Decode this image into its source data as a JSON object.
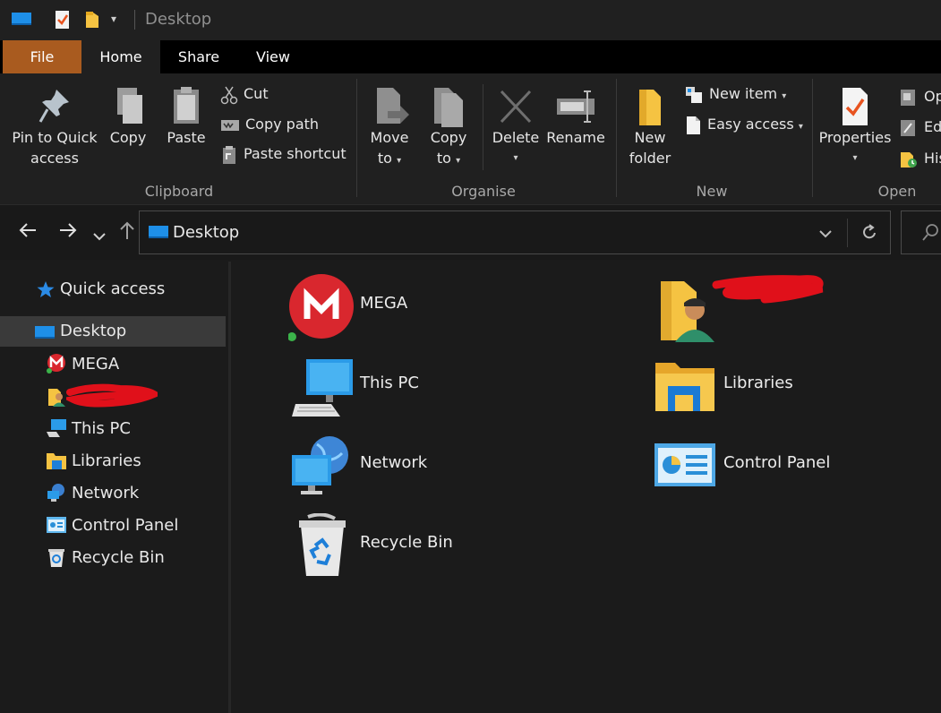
{
  "window": {
    "title": "Desktop"
  },
  "tabs": [
    {
      "label": "File"
    },
    {
      "label": "Home"
    },
    {
      "label": "Share"
    },
    {
      "label": "View"
    }
  ],
  "ribbon": {
    "clipboard": {
      "label": "Clipboard",
      "pin_quick_access": [
        "Pin to Quick",
        "access"
      ],
      "copy": "Copy",
      "paste": "Paste",
      "cut": "Cut",
      "copy_path": "Copy path",
      "paste_shortcut": "Paste shortcut"
    },
    "organise": {
      "label": "Organise",
      "move_to": [
        "Move",
        "to"
      ],
      "copy_to": [
        "Copy",
        "to"
      ],
      "delete": "Delete",
      "rename": "Rename"
    },
    "new": {
      "label": "New",
      "new_folder": [
        "New",
        "folder"
      ],
      "new_item": "New item",
      "easy_access": "Easy access"
    },
    "open": {
      "label": "Open",
      "properties": "Properties",
      "open_partial": "Op",
      "edit_partial": "Edi",
      "history_partial": "His"
    }
  },
  "address": {
    "path": "Desktop"
  },
  "sidebar": {
    "items": [
      {
        "label": "Quick access",
        "icon": "star-icon"
      },
      {
        "label": "Desktop",
        "icon": "desktop-icon",
        "selected": true
      },
      {
        "label": "MEGA",
        "icon": "mega-icon"
      },
      {
        "label": "",
        "icon": "user-folder-icon",
        "redacted": true
      },
      {
        "label": "This PC",
        "icon": "pc-icon"
      },
      {
        "label": "Libraries",
        "icon": "libraries-icon"
      },
      {
        "label": "Network",
        "icon": "network-icon"
      },
      {
        "label": "Control Panel",
        "icon": "control-panel-icon"
      },
      {
        "label": "Recycle Bin",
        "icon": "recycle-bin-icon"
      }
    ]
  },
  "content": {
    "items": [
      {
        "label": "MEGA",
        "icon": "mega-icon"
      },
      {
        "label": "",
        "icon": "user-folder-icon",
        "redacted": true
      },
      {
        "label": "This PC",
        "icon": "pc-icon"
      },
      {
        "label": "Libraries",
        "icon": "libraries-icon"
      },
      {
        "label": "Network",
        "icon": "network-icon"
      },
      {
        "label": "Control Panel",
        "icon": "control-panel-icon"
      },
      {
        "label": "Recycle Bin",
        "icon": "recycle-bin-icon"
      }
    ]
  },
  "colors": {
    "file_tab": "#a95b1f",
    "mega_red": "#d9272e",
    "folder_yellow": "#f5c342",
    "accent_blue": "#1e90ff",
    "redaction_red": "#e0101a"
  }
}
